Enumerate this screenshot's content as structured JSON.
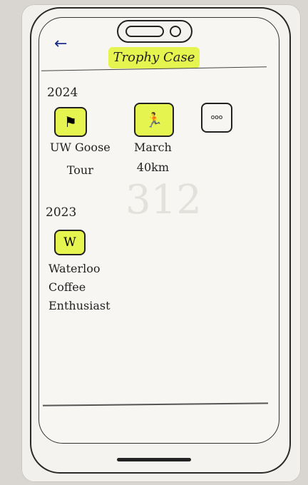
{
  "header": {
    "back_icon": "left-arrow",
    "title": "Trophy Case",
    "accent": "#e6f44f"
  },
  "sections": [
    {
      "year": "2024",
      "badges": [
        {
          "icon": "flag-icon",
          "glyph": "⚑",
          "label_lines": [
            "UW Goose",
            "Tour"
          ],
          "highlighted": true
        },
        {
          "icon": "runner-icon",
          "glyph": "🏃",
          "label_lines": [
            "March",
            "40km"
          ],
          "highlighted": true
        },
        {
          "icon": "ellipsis-icon",
          "glyph": "ooo",
          "label_lines": [],
          "highlighted": false
        }
      ]
    },
    {
      "year": "2023",
      "badges": [
        {
          "icon": "w-letter-icon",
          "glyph": "W",
          "label_lines": [
            "Waterloo",
            "Coffee",
            "Enthusiast"
          ],
          "highlighted": true
        }
      ]
    }
  ]
}
